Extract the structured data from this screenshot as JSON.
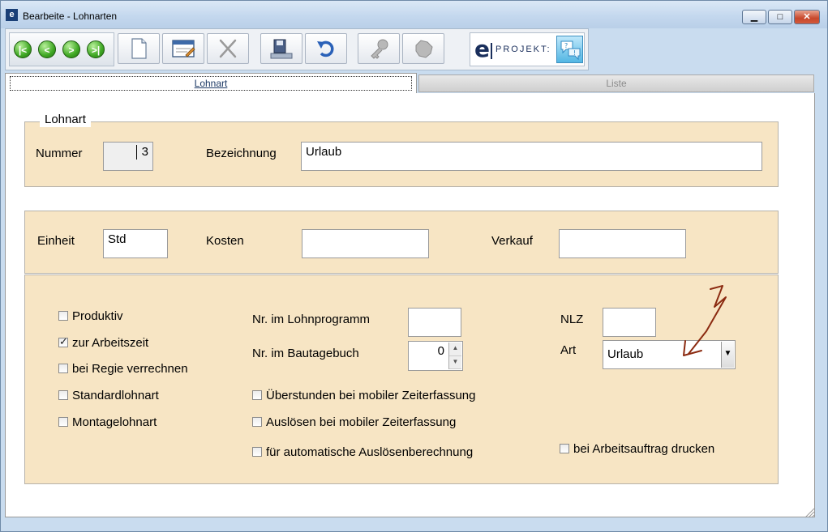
{
  "window": {
    "title": "Bearbeite - Lohnarten",
    "app_icon_label": "e",
    "minimize_label": "▁",
    "maximize_label": "□",
    "close_label": "✕"
  },
  "logo": {
    "e": "e",
    "text": "PROJEKT:"
  },
  "tabs": [
    {
      "label": "Lohnart",
      "active": true
    },
    {
      "label": "Liste",
      "active": false
    }
  ],
  "lohnart": {
    "legend": "Lohnart",
    "nummer_label": "Nummer",
    "nummer_value": "3",
    "bezeichnung_label": "Bezeichnung",
    "bezeichnung_value": "Urlaub"
  },
  "einheit": {
    "einheit_label": "Einheit",
    "einheit_value": "Std",
    "kosten_label": "Kosten",
    "kosten_value": "",
    "verkauf_label": "Verkauf",
    "verkauf_value": ""
  },
  "options": {
    "produktiv": {
      "label": "Produktiv",
      "checked": false
    },
    "zur_arbeitszeit": {
      "label": "zur Arbeitszeit",
      "checked": true
    },
    "bei_regie": {
      "label": "bei Regie verrechnen",
      "checked": false
    },
    "standard": {
      "label": "Standardlohnart",
      "checked": false
    },
    "montage": {
      "label": "Montagelohnart",
      "checked": false
    },
    "ueberstunden": {
      "label": "Überstunden bei mobiler Zeiterfassung",
      "checked": false
    },
    "ausloesen": {
      "label": "Auslösen bei mobiler Zeiterfassung",
      "checked": false
    },
    "auto_ausloesen": {
      "label": "für automatische Auslösenberechnung",
      "checked": false
    },
    "arbeitsauftrag": {
      "label": "bei Arbeitsauftrag drucken",
      "checked": false
    },
    "lohnprogramm_label": "Nr. im Lohnprogramm",
    "lohnprogramm_value": "",
    "bautagebuch_label": "Nr. im Bautagebuch",
    "bautagebuch_value": "0",
    "nlz_label": "NLZ",
    "nlz_value": "",
    "art_label": "Art",
    "art_value": "Urlaub"
  },
  "colors": {
    "panel": "#f7e5c4",
    "annotation": "#8b2a10"
  }
}
